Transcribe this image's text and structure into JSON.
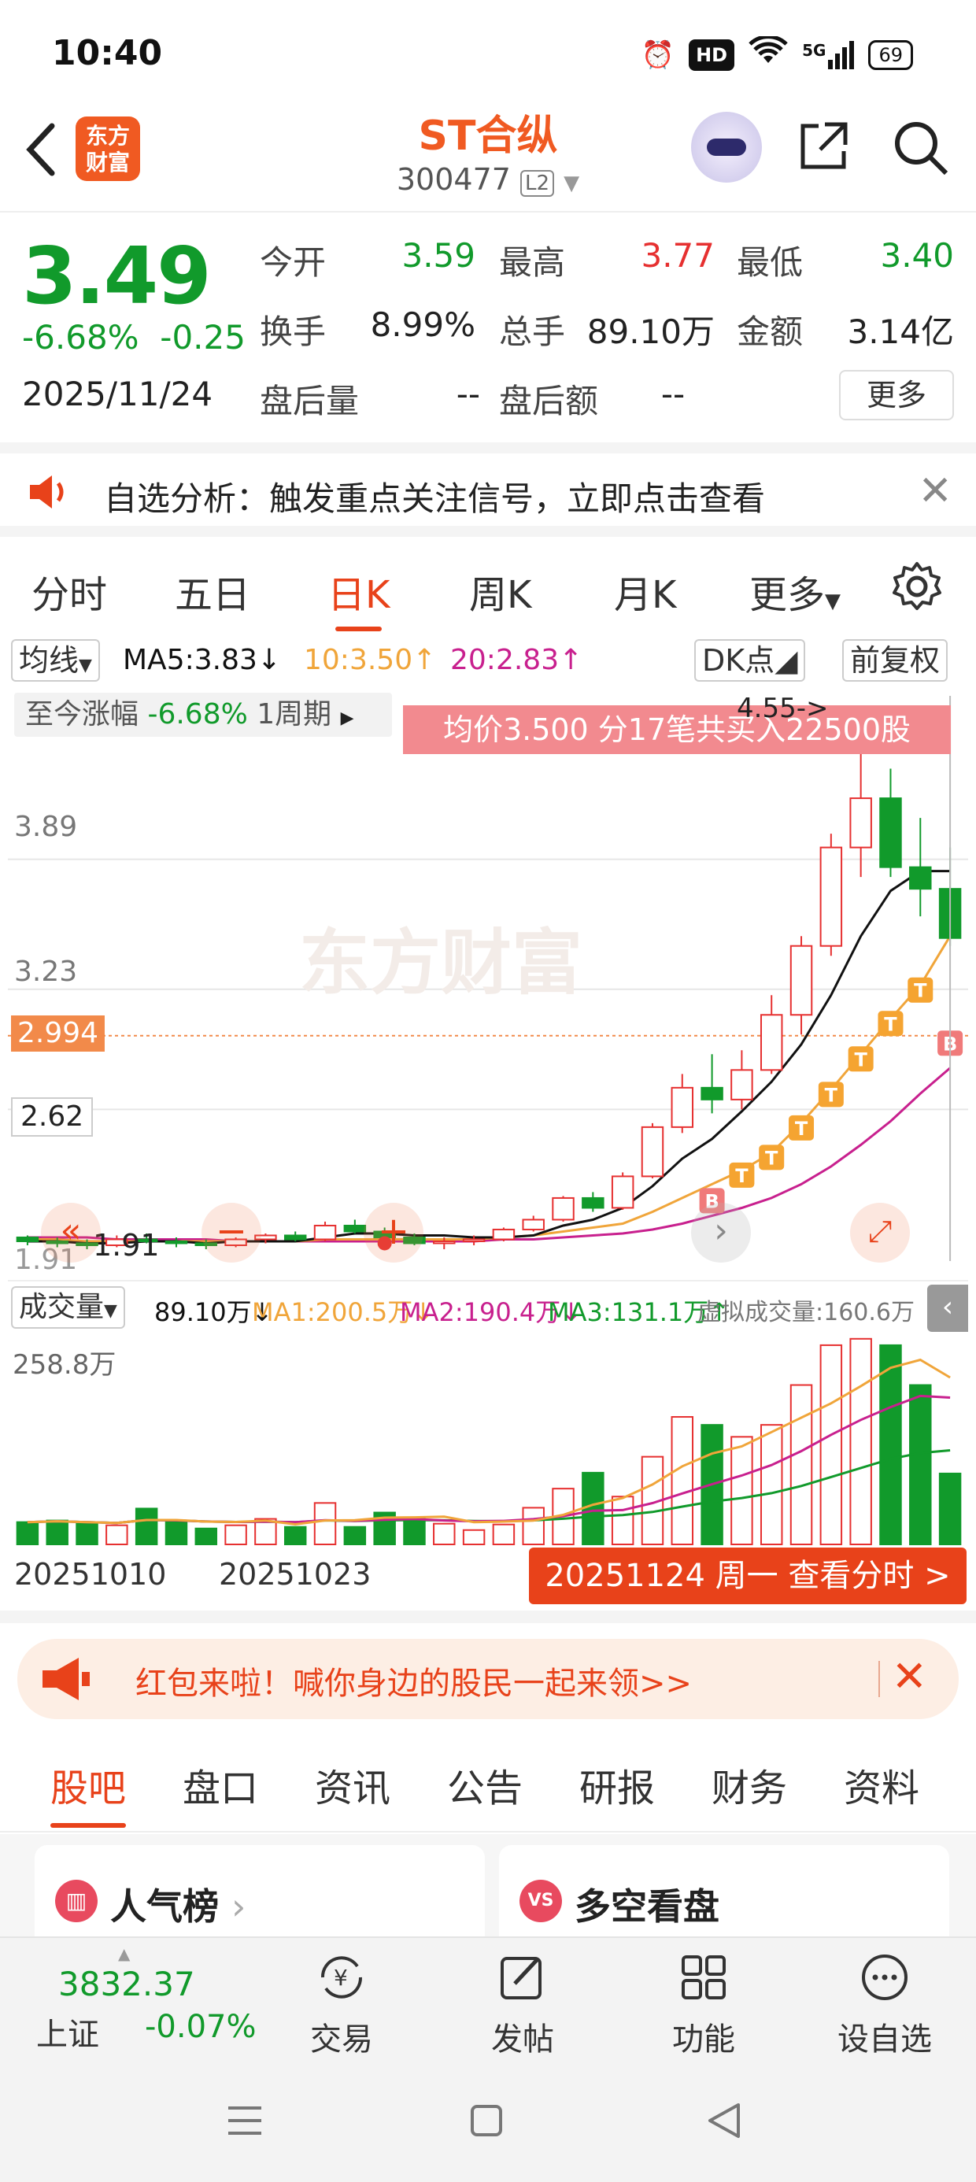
{
  "status_bar": {
    "time": "10:40",
    "hd": "HD",
    "network": "5G",
    "battery": "69"
  },
  "header": {
    "logo_text": "东方财富",
    "title": "ST合纵",
    "code": "300477",
    "level": "L2"
  },
  "quote": {
    "price": "3.49",
    "change_pct": "-6.68%",
    "change": "-0.25",
    "date": "2025/11/24",
    "open_label": "今开",
    "open": "3.59",
    "high_label": "最高",
    "high": "3.77",
    "low_label": "最低",
    "low": "3.40",
    "turnover_label": "换手",
    "turnover": "8.99%",
    "volume_label": "总手",
    "volume": "89.10万",
    "amount_label": "金额",
    "amount": "3.14亿",
    "after_vol_label": "盘后量",
    "after_vol": "--",
    "after_amt_label": "盘后额",
    "after_amt": "--",
    "more": "更多"
  },
  "notice": {
    "text": "自选分析：触发重点关注信号，立即点击查看"
  },
  "period_tabs": [
    "分时",
    "五日",
    "日K",
    "周K",
    "月K",
    "更多"
  ],
  "active_period": "日K",
  "ma_row": {
    "selector": "均线",
    "ma5": "MA5:3.83",
    "ma10": "10:3.50",
    "ma20": "20:2.83",
    "dk": "DK点",
    "adjust": "前复权"
  },
  "kline_info": {
    "range_label": "至今涨幅",
    "range_pct": "-6.68%",
    "range_period": "1周期",
    "banner": "均价3.500  分17笔共买入22500股",
    "price_ticks": [
      "3.89",
      "3.23",
      "2.62"
    ],
    "marker": "2.994",
    "high_note": "4.55->",
    "low_note": "1.91",
    "low_left": "1.91",
    "watermark": "东方财富"
  },
  "colors": {
    "up": "#e63030",
    "down": "#119a2b",
    "accent": "#e8421a",
    "ma5": "#111111",
    "ma10": "#f0a53a",
    "ma20": "#c8208e"
  },
  "chart_data": {
    "type": "candlestick",
    "x": [
      "20251010",
      "",
      "",
      "",
      "",
      "",
      "",
      "",
      "20251023",
      "",
      "",
      "",
      "",
      "",
      "",
      "",
      "",
      "",
      "",
      "",
      "",
      "",
      "",
      "",
      "",
      "",
      "",
      "",
      "",
      "",
      "",
      "20251124"
    ],
    "ohlc": [
      [
        1.97,
        1.98,
        1.93,
        1.95
      ],
      [
        1.95,
        1.97,
        1.92,
        1.94
      ],
      [
        1.94,
        1.96,
        1.91,
        1.93
      ],
      [
        1.93,
        1.98,
        1.92,
        1.96
      ],
      [
        1.96,
        1.99,
        1.94,
        1.95
      ],
      [
        1.95,
        1.97,
        1.92,
        1.94
      ],
      [
        1.94,
        1.96,
        1.91,
        1.93
      ],
      [
        1.93,
        1.97,
        1.92,
        1.96
      ],
      [
        1.96,
        1.99,
        1.94,
        1.98
      ],
      [
        1.98,
        2.0,
        1.95,
        1.96
      ],
      [
        1.96,
        2.05,
        1.95,
        2.03
      ],
      [
        2.03,
        2.06,
        1.99,
        2.0
      ],
      [
        2.0,
        2.02,
        1.95,
        1.97
      ],
      [
        1.97,
        1.99,
        1.93,
        1.94
      ],
      [
        1.94,
        1.97,
        1.91,
        1.95
      ],
      [
        1.95,
        1.98,
        1.93,
        1.96
      ],
      [
        1.96,
        2.02,
        1.95,
        2.01
      ],
      [
        2.01,
        2.08,
        2.0,
        2.06
      ],
      [
        2.06,
        2.18,
        2.05,
        2.17
      ],
      [
        2.17,
        2.2,
        2.1,
        2.12
      ],
      [
        2.12,
        2.3,
        2.11,
        2.28
      ],
      [
        2.28,
        2.55,
        2.27,
        2.53
      ],
      [
        2.53,
        2.8,
        2.5,
        2.73
      ],
      [
        2.73,
        2.9,
        2.6,
        2.67
      ],
      [
        2.67,
        2.92,
        2.62,
        2.82
      ],
      [
        2.82,
        3.2,
        2.8,
        3.1
      ],
      [
        3.1,
        3.5,
        3.0,
        3.45
      ],
      [
        3.45,
        4.02,
        3.4,
        3.95
      ],
      [
        3.95,
        4.55,
        3.8,
        4.2
      ],
      [
        4.2,
        4.35,
        3.8,
        3.85
      ],
      [
        3.85,
        4.1,
        3.6,
        3.74
      ],
      [
        3.74,
        3.95,
        3.45,
        3.49
      ]
    ],
    "ma5": [
      1.95,
      1.95,
      1.94,
      1.94,
      1.95,
      1.95,
      1.94,
      1.95,
      1.95,
      1.95,
      1.97,
      1.99,
      1.99,
      1.98,
      1.98,
      1.97,
      1.97,
      1.98,
      2.03,
      2.06,
      2.12,
      2.23,
      2.37,
      2.47,
      2.61,
      2.76,
      2.95,
      3.2,
      3.5,
      3.73,
      3.83,
      3.83
    ],
    "ma10": [
      1.96,
      1.96,
      1.95,
      1.95,
      1.95,
      1.95,
      1.95,
      1.95,
      1.95,
      1.95,
      1.96,
      1.96,
      1.96,
      1.96,
      1.96,
      1.96,
      1.97,
      1.98,
      2.0,
      2.02,
      2.04,
      2.1,
      2.17,
      2.24,
      2.31,
      2.4,
      2.55,
      2.72,
      2.9,
      3.08,
      3.25,
      3.5
    ],
    "ma20": [
      1.97,
      1.97,
      1.97,
      1.96,
      1.96,
      1.96,
      1.96,
      1.95,
      1.95,
      1.95,
      1.95,
      1.95,
      1.95,
      1.95,
      1.95,
      1.95,
      1.96,
      1.96,
      1.97,
      1.98,
      1.99,
      2.01,
      2.04,
      2.08,
      2.12,
      2.17,
      2.24,
      2.33,
      2.44,
      2.56,
      2.7,
      2.83
    ],
    "volume": [
      28,
      30,
      26,
      24,
      45,
      28,
      20,
      24,
      32,
      22,
      52,
      22,
      40,
      34,
      26,
      18,
      25,
      46,
      70,
      90,
      60,
      110,
      160,
      150,
      135,
      150,
      200,
      250,
      258,
      250,
      200,
      89
    ],
    "ylim": [
      1.85,
      4.6
    ],
    "vol_max": "258.8万"
  },
  "volume_row": {
    "selector": "成交量",
    "vol": "89.10万",
    "ma1": "MA1:200.5万",
    "ma2": "MA2:190.4万",
    "ma3": "MA3:131.1万",
    "virtual": "虚拟成交量:160.6万"
  },
  "date_axis": {
    "start": "20251010",
    "mid": "20251023",
    "button": "20251124 周一 查看分时 >"
  },
  "promo": {
    "text": "红包来啦！喊你身边的股民一起来领>>"
  },
  "bottom_tabs": [
    "股吧",
    "盘口",
    "资讯",
    "公告",
    "研报",
    "财务",
    "资料"
  ],
  "cards": [
    {
      "icon": "chart-bar-icon",
      "label": "人气榜"
    },
    {
      "icon": "vs-icon",
      "label": "多空看盘"
    }
  ],
  "bottom_nav": {
    "index_value": "3832.37",
    "index_name": "上证",
    "index_pct": "-0.07%",
    "items": [
      "交易",
      "发帖",
      "功能",
      "设自选"
    ]
  }
}
